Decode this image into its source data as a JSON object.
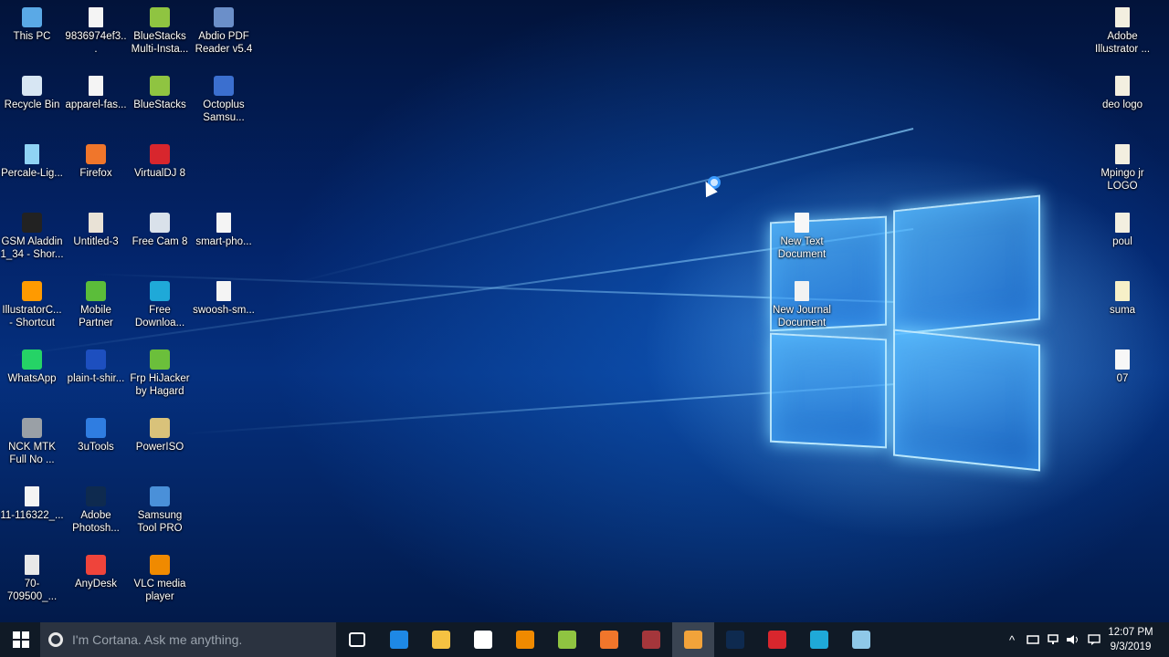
{
  "desktop": {
    "icons_left": [
      {
        "label": "This PC",
        "icon": "computer-icon",
        "color": "#5aa9e6"
      },
      {
        "label": "9836974ef3...",
        "icon": "image-file-icon",
        "color": "#f4f4f4"
      },
      {
        "label": "BlueStacks Multi-Insta...",
        "icon": "bluestacks-icon",
        "color": "#8fc441"
      },
      {
        "label": "Abdio PDF Reader v5.4",
        "icon": "pdf-reader-icon",
        "color": "#6b8fc9"
      },
      {
        "label": "Recycle Bin",
        "icon": "recycle-bin-icon",
        "color": "#d7e6f3"
      },
      {
        "label": "apparel-fas...",
        "icon": "image-file-icon",
        "color": "#f4f4f4"
      },
      {
        "label": "BlueStacks",
        "icon": "bluestacks-icon",
        "color": "#8fc441"
      },
      {
        "label": "Octoplus Samsu...",
        "icon": "octoplus-icon",
        "color": "#3b6fcf"
      },
      {
        "label": "Percale-Lig...",
        "icon": "image-file-icon",
        "color": "#8fd3f5"
      },
      {
        "label": "Firefox",
        "icon": "firefox-icon",
        "color": "#f0762b"
      },
      {
        "label": "VirtualDJ 8",
        "icon": "virtualdj-icon",
        "color": "#d8262d"
      },
      {
        "label": "GSM Aladdin 1_34 - Shor...",
        "icon": "gsm-aladdin-icon",
        "color": "#222222"
      },
      {
        "label": "Untitled-3",
        "icon": "image-file-icon",
        "color": "#e9e2d6"
      },
      {
        "label": "Free Cam 8",
        "icon": "freecam-icon",
        "color": "#d9e1ea"
      },
      {
        "label": "smart-pho...",
        "icon": "image-file-icon",
        "color": "#f4f4f4"
      },
      {
        "label": "IllustratorC... - Shortcut",
        "icon": "illustrator-icon",
        "color": "#ff9a00"
      },
      {
        "label": "Mobile Partner",
        "icon": "mobile-partner-icon",
        "color": "#5bbd3a"
      },
      {
        "label": "Free Downloa...",
        "icon": "free-download-icon",
        "color": "#1fa9d8"
      },
      {
        "label": "swoosh-sm...",
        "icon": "image-file-icon",
        "color": "#f4f4f4"
      },
      {
        "label": "WhatsApp",
        "icon": "whatsapp-icon",
        "color": "#25d366"
      },
      {
        "label": "plain-t-shir...",
        "icon": "tshirt-icon",
        "color": "#1d4fbf"
      },
      {
        "label": "Frp HiJacker by Hagard",
        "icon": "frp-hijacker-icon",
        "color": "#6bbf3b"
      },
      {
        "label": "NCK MTK Full No ...",
        "icon": "nck-icon",
        "color": "#9aa0a6"
      },
      {
        "label": "3uTools",
        "icon": "3utools-icon",
        "color": "#2f7de1"
      },
      {
        "label": "PowerISO",
        "icon": "poweriso-icon",
        "color": "#d9c27a"
      },
      {
        "label": "11-116322_...",
        "icon": "image-file-icon",
        "color": "#f4f4f4"
      },
      {
        "label": "Adobe Photosh...",
        "icon": "photoshop-icon",
        "color": "#0e2a4f"
      },
      {
        "label": "Samsung Tool PRO",
        "icon": "samsung-tool-icon",
        "color": "#4a90d9"
      },
      {
        "label": "70-709500_...",
        "icon": "image-file-icon",
        "color": "#e8e8e8"
      },
      {
        "label": "AnyDesk",
        "icon": "anydesk-icon",
        "color": "#ef443b"
      },
      {
        "label": "VLC media player",
        "icon": "vlc-icon",
        "color": "#f08a00"
      }
    ],
    "icons_middle": [
      {
        "label": "New Text Document",
        "icon": "text-file-icon",
        "color": "#f7f7f7"
      },
      {
        "label": "New Journal Document",
        "icon": "journal-file-icon",
        "color": "#f2f2f2"
      }
    ],
    "icons_right": [
      {
        "label": "Adobe Illustrator ...",
        "icon": "file-icon",
        "color": "#f3efe0"
      },
      {
        "label": "deo logo",
        "icon": "file-icon",
        "color": "#f3efe0"
      },
      {
        "label": "Mpingo jr LOGO",
        "icon": "file-icon",
        "color": "#f3efe0"
      },
      {
        "label": "poul",
        "icon": "file-icon",
        "color": "#f3efe0"
      },
      {
        "label": "suma",
        "icon": "file-icon",
        "color": "#f7f0c8"
      },
      {
        "label": "07",
        "icon": "text-file-icon",
        "color": "#f7f7f7"
      }
    ]
  },
  "taskbar": {
    "start_icon": "windows-start-icon",
    "search_placeholder": "I'm Cortana. Ask me anything.",
    "apps": [
      {
        "icon": "task-view-icon",
        "color": "#ffffff"
      },
      {
        "icon": "edge-icon",
        "color": "#1e88e5"
      },
      {
        "icon": "file-explorer-icon",
        "color": "#f5c242"
      },
      {
        "icon": "store-icon",
        "color": "#ffffff"
      },
      {
        "icon": "vlc-icon",
        "color": "#f08a00"
      },
      {
        "icon": "bluestacks-icon",
        "color": "#8fc441"
      },
      {
        "icon": "firefox-icon",
        "color": "#f0762b"
      },
      {
        "icon": "winrar-icon",
        "color": "#a4363b"
      },
      {
        "icon": "media-player-icon",
        "color": "#f2a33a"
      },
      {
        "icon": "photoshop-icon",
        "color": "#0e2a4f"
      },
      {
        "icon": "ruby-icon",
        "color": "#d8262d"
      },
      {
        "icon": "free-download-icon",
        "color": "#1fa9d8"
      },
      {
        "icon": "notepad-icon",
        "color": "#8fc8e8"
      }
    ],
    "tray": {
      "chevron": "^",
      "time": "12:07 PM",
      "date": "9/3/2019"
    }
  }
}
